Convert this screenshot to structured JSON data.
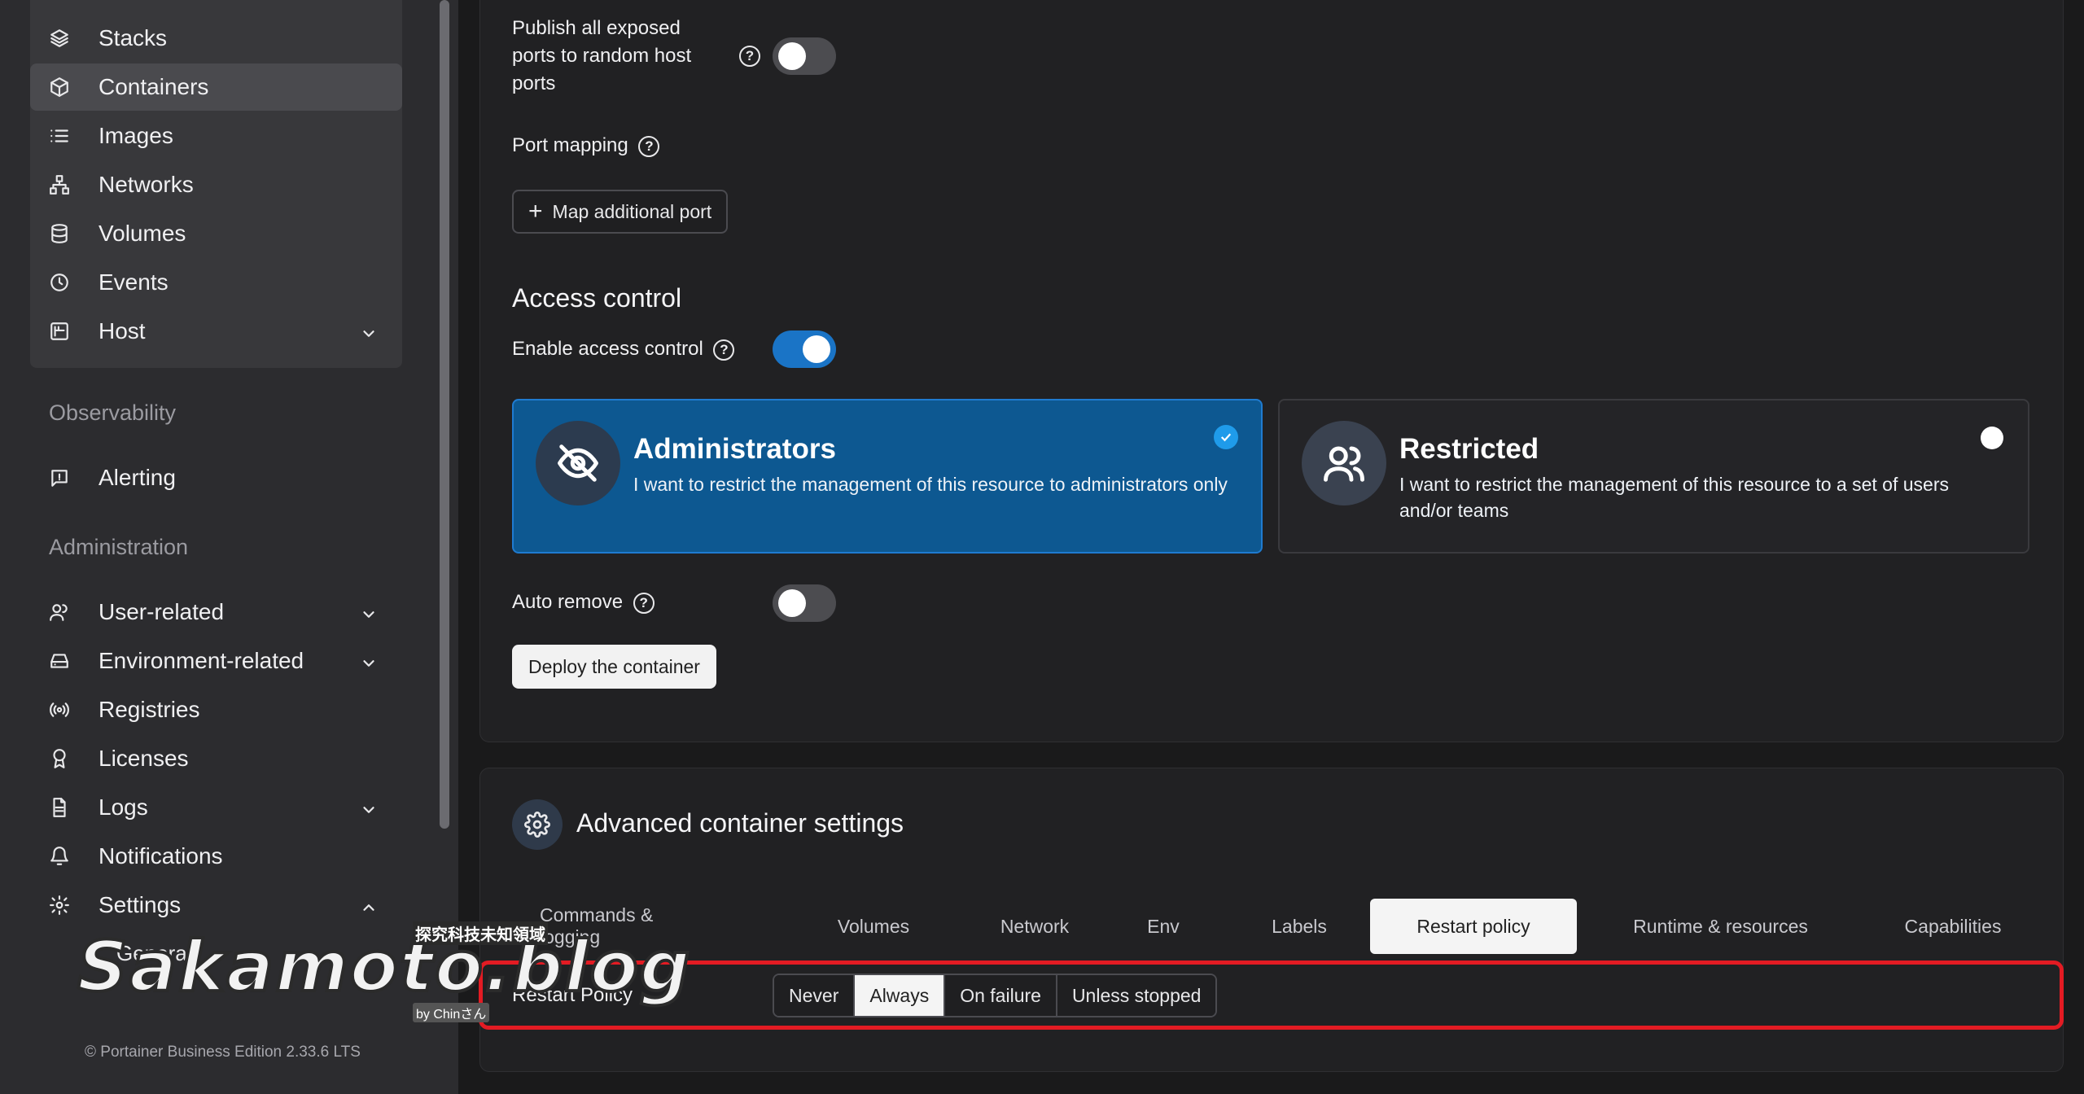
{
  "sidebar": {
    "items": [
      {
        "label": "Stacks",
        "icon": "stack-icon"
      },
      {
        "label": "Containers",
        "icon": "cube-icon"
      },
      {
        "label": "Images",
        "icon": "list-icon"
      },
      {
        "label": "Networks",
        "icon": "network-icon"
      },
      {
        "label": "Volumes",
        "icon": "database-icon"
      },
      {
        "label": "Events",
        "icon": "clock-icon"
      },
      {
        "label": "Host",
        "icon": "host-icon"
      }
    ],
    "observability_label": "Observability",
    "observability_items": [
      {
        "label": "Alerting",
        "icon": "alert-icon"
      }
    ],
    "administration_label": "Administration",
    "administration_items": [
      {
        "label": "User-related",
        "icon": "users-icon"
      },
      {
        "label": "Environment-related",
        "icon": "drive-icon"
      },
      {
        "label": "Registries",
        "icon": "radio-icon"
      },
      {
        "label": "Licenses",
        "icon": "award-icon"
      },
      {
        "label": "Logs",
        "icon": "file-icon"
      },
      {
        "label": "Notifications",
        "icon": "bell-icon"
      },
      {
        "label": "Settings",
        "icon": "gear-icon"
      }
    ],
    "settings_sub": "General",
    "footer": "© Portainer Business Edition 2.33.6 LTS"
  },
  "network": {
    "publish_label": "Publish all exposed ports to random host ports",
    "port_mapping_label": "Port mapping",
    "map_port_button": "Map additional port"
  },
  "access": {
    "heading": "Access control",
    "enable_label": "Enable access control",
    "admin_title": "Administrators",
    "admin_desc": "I want to restrict the management of this resource to administrators only",
    "restricted_title": "Restricted",
    "restricted_desc": "I want to restrict the management of this resource to a set of users and/or teams",
    "auto_remove_label": "Auto remove",
    "deploy_button": "Deploy the container"
  },
  "advanced": {
    "heading": "Advanced container settings",
    "tabs": [
      "Commands & logging",
      "Volumes",
      "Network",
      "Env",
      "Labels",
      "Restart policy",
      "Runtime & resources",
      "Capabilities"
    ],
    "active_tab": "Restart policy",
    "restart_label": "Restart Policy",
    "restart_options": [
      "Never",
      "Always",
      "On failure",
      "Unless stopped"
    ],
    "restart_selected": "Always"
  },
  "watermark": {
    "main": "Sakamoto.blog",
    "top": "探究科技未知領域",
    "by": "by Chinさん"
  },
  "colors": {
    "accent": "#1a74c6",
    "admin_card": "#0d5891",
    "highlight": "#e31b23"
  }
}
